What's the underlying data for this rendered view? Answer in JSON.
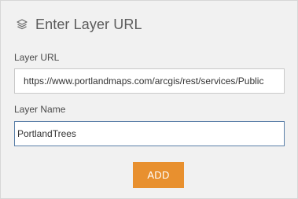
{
  "header": {
    "title": "Enter Layer URL",
    "icon": "layers-icon"
  },
  "form": {
    "url_label": "Layer URL",
    "url_value": "https://www.portlandmaps.com/arcgis/rest/services/Public",
    "name_label": "Layer Name",
    "name_value": "PortlandTrees",
    "add_label": "ADD"
  },
  "colors": {
    "panel_bg": "#f1f1f1",
    "accent": "#e8902f",
    "focus_border": "#5a7fa8"
  }
}
